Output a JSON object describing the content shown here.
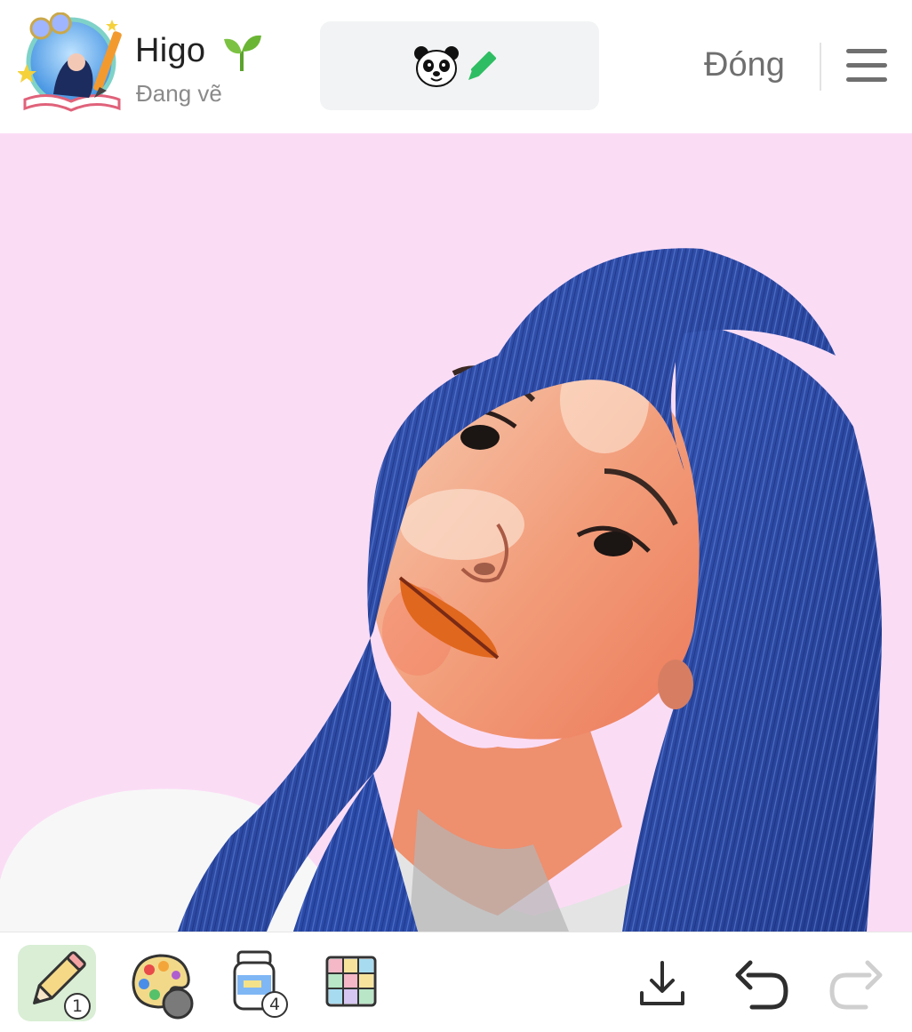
{
  "header": {
    "user_name": "Higo",
    "status": "Đang vẽ",
    "close_label": "Đóng"
  },
  "toolbar": {
    "pencil_badge": "1",
    "layers_badge": "4"
  },
  "colors": {
    "canvas_background": "#fbdcf5",
    "active_tool_background": "#d9eed5",
    "hair": "#2d4ca3"
  },
  "icons": {
    "header": [
      "avatar",
      "sprout-icon",
      "panda-icon",
      "pencil-icon",
      "menu-icon"
    ],
    "toolbar": [
      "pencil-icon",
      "palette-icon",
      "paint-jar-icon",
      "grid-icon",
      "download-icon",
      "undo-icon",
      "redo-icon"
    ]
  }
}
